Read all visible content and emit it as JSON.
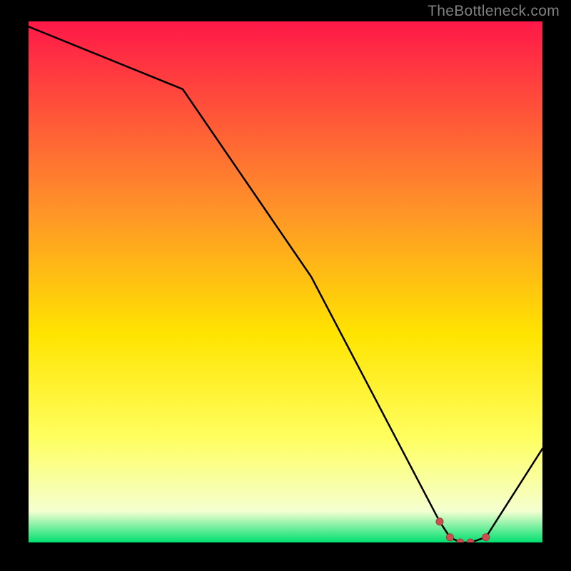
{
  "watermark": "TheBottleneck.com",
  "chart_data": {
    "type": "line",
    "title": "",
    "xlabel": "",
    "ylabel": "",
    "xlim": [
      0,
      100
    ],
    "ylim": [
      0,
      100
    ],
    "x": [
      0,
      5,
      30,
      55,
      80,
      82,
      84,
      86,
      89,
      100
    ],
    "values": [
      99,
      97,
      87,
      51,
      4,
      1,
      0,
      0,
      1,
      18
    ],
    "marker_indices": [
      4,
      5,
      6,
      7,
      8
    ],
    "colors": {
      "line": "#000000",
      "marker_fill": "#cd4e4e",
      "marker_stroke": "#a43c3c",
      "gradient_top": "#ff1848",
      "gradient_mid_upper": "#ff8f2a",
      "gradient_mid": "#ffe400",
      "gradient_mid_lower": "#ffff60",
      "gradient_low": "#f5ffd0",
      "gradient_bottom": "#00e070"
    }
  }
}
